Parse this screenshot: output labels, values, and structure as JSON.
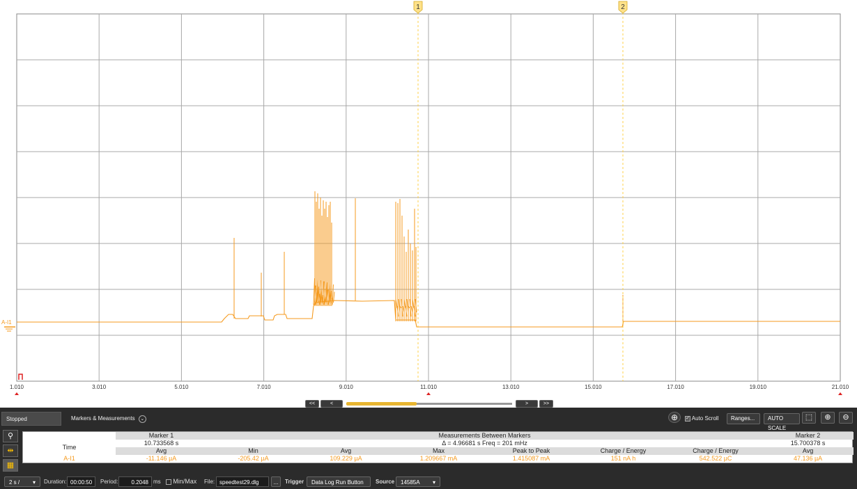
{
  "plot": {
    "x_ticks": [
      "1.010",
      "3.010",
      "5.010",
      "7.010",
      "9.010",
      "11.010",
      "13.010",
      "15.010",
      "17.010",
      "19.010",
      "21.010"
    ],
    "channel_label": "A-I1",
    "trace_color": "#f59a1e",
    "marker1_label": "1",
    "marker2_label": "2",
    "marker_color": "#ffd24a"
  },
  "scroll": {
    "first_label": "<<",
    "prev_label": "<",
    "next_label": ">",
    "last_label": ">>"
  },
  "toolbar": {
    "stopped_label": "Stopped",
    "tab_label": "Markers & Measurements",
    "auto_scroll_label": "Auto Scroll",
    "ranges_label": "Ranges...",
    "autoscale_label": "AUTO SCALE"
  },
  "measurements": {
    "time_label": "Time",
    "marker1": {
      "title": "Marker 1",
      "time": "10.733568 s",
      "avg_label": "Avg",
      "avg_value": "-11.146 µA"
    },
    "between": {
      "title": "Measurements Between Markers",
      "delta": "Δ = 4.96681 s    Freq = 201 mHz",
      "headers": [
        "Min",
        "Avg",
        "Max",
        "Peak to Peak",
        "Charge / Energy",
        "Charge / Energy"
      ],
      "values": [
        "-205.42 µA",
        "109.229 µA",
        "1.209667 mA",
        "1.415087 mA",
        "151 nA h",
        "542.522 µC"
      ]
    },
    "marker2": {
      "title": "Marker 2",
      "time": "15.700378 s",
      "avg_label": "Avg",
      "avg_value": "47.136 µA"
    },
    "channel": "A-I1"
  },
  "status": {
    "timebase": "2 s /",
    "duration_label": "Duration:",
    "duration_value": "00:00:50",
    "period_label": "Period:",
    "period_value": "0.2048",
    "period_unit": "ms",
    "minmax_label": "Min/Max",
    "file_label": "File:",
    "file_value": "speedtest29.dlg",
    "browse_label": "...",
    "trigger_label": "Trigger",
    "trigger_value": "Data Log Run Button",
    "source_label": "Source",
    "source_value": "14585A"
  }
}
